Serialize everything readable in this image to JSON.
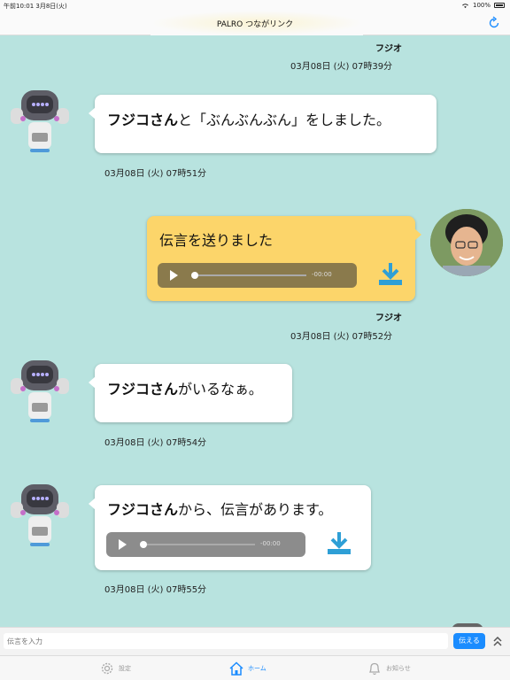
{
  "status_bar": {
    "time_date": "午前10:01  3月8日(火)",
    "battery": "100%"
  },
  "nav": {
    "title": "PALRO つながリンク"
  },
  "messages": [
    {
      "sender": "フジオ",
      "timestamp": "03月08日 (火) 07時39分"
    },
    {
      "bold": "フジコさん",
      "text": "と「ぶんぶんぶん」をしました。",
      "timestamp": "03月08日 (火) 07時51分"
    },
    {
      "text": "伝言を送りました",
      "time": "-00:00",
      "sender": "フジオ",
      "timestamp": "03月08日 (火) 07時52分"
    },
    {
      "bold": "フジコさん",
      "text": "がいるなぁ。",
      "timestamp": "03月08日 (火) 07時54分"
    },
    {
      "bold": "フジコさん",
      "text": "から、伝言があります。",
      "time": "-00:00",
      "timestamp": "03月08日 (火) 07時55分"
    }
  ],
  "input": {
    "placeholder": "伝言を入力",
    "send_label": "伝える"
  },
  "tabs": [
    {
      "label": "設定",
      "icon": "gear-icon"
    },
    {
      "label": "ホーム",
      "icon": "home-icon"
    },
    {
      "label": "お知らせ",
      "icon": "bell-icon"
    }
  ],
  "colors": {
    "background": "#b8e3df",
    "accent": "#1a8cff",
    "own_bubble": "#fcd56a",
    "download_icon": "#2e9fd6"
  }
}
